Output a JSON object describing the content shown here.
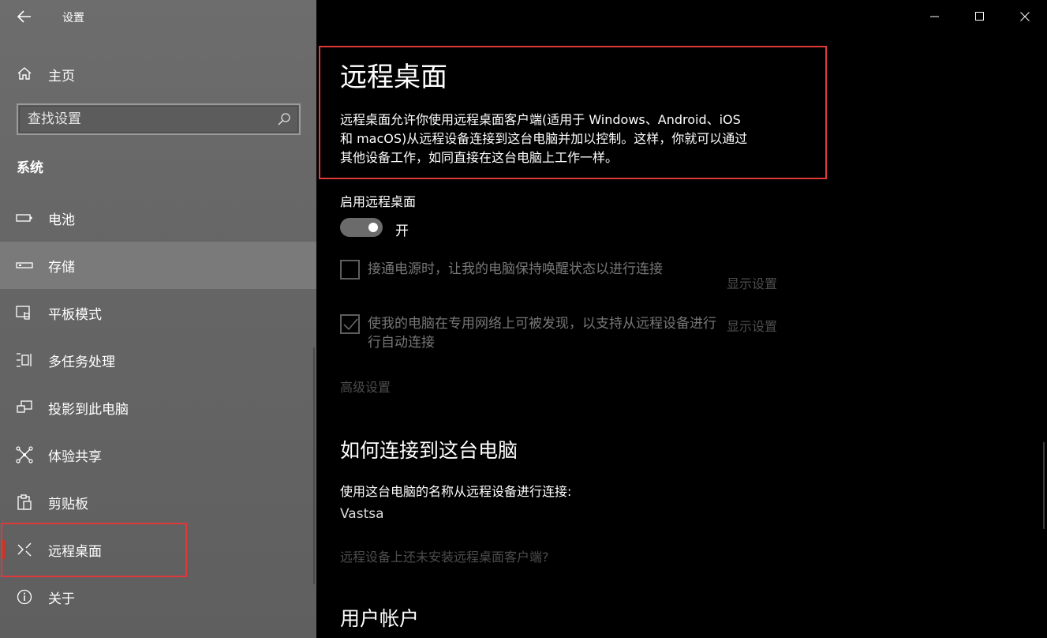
{
  "window": {
    "app_title": "设置",
    "back_icon": "arrow-left-icon",
    "controls": [
      "minimize-icon",
      "maximize-icon",
      "close-icon"
    ]
  },
  "sidebar": {
    "home_label": "主页",
    "search_placeholder": "查找设置",
    "section_label": "系统",
    "items": [
      {
        "label": "电池",
        "icon": "battery-icon"
      },
      {
        "label": "存储",
        "icon": "storage-icon"
      },
      {
        "label": "平板模式",
        "icon": "tablet-mode-icon"
      },
      {
        "label": "多任务处理",
        "icon": "multitasking-icon"
      },
      {
        "label": "投影到此电脑",
        "icon": "project-icon"
      },
      {
        "label": "体验共享",
        "icon": "share-icon"
      },
      {
        "label": "剪贴板",
        "icon": "clipboard-icon"
      },
      {
        "label": "远程桌面",
        "icon": "remote-desktop-icon"
      },
      {
        "label": "关于",
        "icon": "info-icon"
      }
    ],
    "selected": "存储",
    "active": "远程桌面"
  },
  "main": {
    "title": "远程桌面",
    "description_lines": [
      "远程桌面允许你使用远程桌面客户端(适用于 Windows、Android、iOS",
      "和 macOS)从远程设备连接到这台电脑并加以控制。这样，你就可以通过",
      "其他设备工作，如同直接在这台电脑上工作一样。"
    ],
    "enable_label": "启用远程桌面",
    "toggle_state": "开",
    "toggle_on": true,
    "option1": {
      "label": "接通电源时，让我的电脑保持唤醒状态以进行连接",
      "checked": false,
      "link": "显示设置"
    },
    "option2": {
      "label_lines": [
        "使我的电脑在专用网络上可被发现，以支持从远程设备进行",
        "行自动连接"
      ],
      "checked": true,
      "link": "显示设置"
    },
    "advanced_link": "高级设置",
    "how_heading": "如何连接到这台电脑",
    "connect_label": "使用这台电脑的名称从远程设备进行连接:",
    "pc_name": "Vastsa",
    "client_link": "远程设备上还未安装远程桌面客户端?",
    "user_heading": "用户帐户"
  },
  "colors": {
    "highlight_box": "#e0393b",
    "sidebar_bg": "#666666",
    "main_bg": "#000000",
    "disabled_text": "#4d4d4d"
  }
}
